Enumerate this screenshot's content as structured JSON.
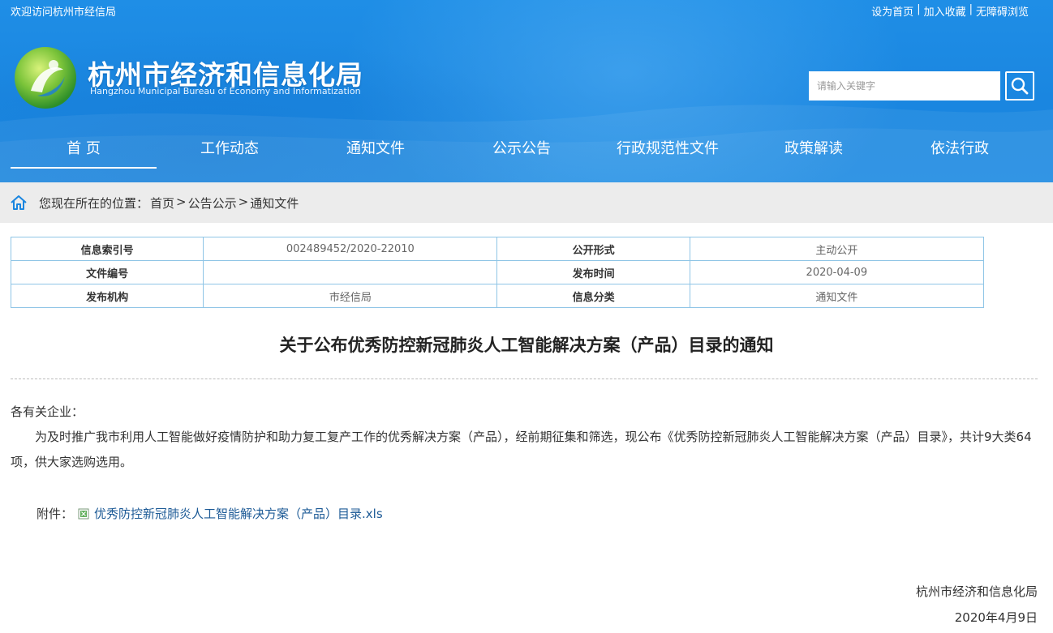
{
  "topbar": {
    "welcome": "欢迎访问杭州市经信局",
    "links": [
      "设为首页",
      "|",
      "加入收藏",
      "|",
      "无障碍浏览"
    ]
  },
  "site": {
    "title": "杭州市经济和信息化局",
    "subtitle": "Hangzhou Municipal Bureau of Economy and Informatization"
  },
  "search": {
    "placeholder": "请输入关键字"
  },
  "nav": {
    "items": [
      {
        "label": "首 页",
        "active": true
      },
      {
        "label": "工作动态"
      },
      {
        "label": "通知文件"
      },
      {
        "label": "公示公告"
      },
      {
        "label": "行政规范性文件"
      },
      {
        "label": "政策解读"
      },
      {
        "label": "依法行政"
      }
    ]
  },
  "breadcrumb": {
    "prefix": "您现在所在的位置：",
    "items": [
      "首页",
      ">",
      "公告公示",
      ">",
      "通知文件"
    ]
  },
  "info": {
    "rows": [
      {
        "k1": "信息索引号",
        "v1": "002489452/2020-22010",
        "k2": "公开形式",
        "v2": "主动公开"
      },
      {
        "k1": "文件编号",
        "v1": "",
        "k2": "发布时间",
        "v2": "2020-04-09"
      },
      {
        "k1": "发布机构",
        "v1": "市经信局",
        "k2": "信息分类",
        "v2": "通知文件"
      }
    ]
  },
  "article": {
    "title": "关于公布优秀防控新冠肺炎人工智能解决方案（产品）目录的通知",
    "greeting": "各有关企业：",
    "paragraph": "为及时推广我市利用人工智能做好疫情防护和助力复工复产工作的优秀解决方案（产品），经前期征集和筛选，现公布《优秀防控新冠肺炎人工智能解决方案（产品）目录》，共计9大类64项，供大家选购选用。",
    "attachment_label": "附件：",
    "attachment_name": "优秀防控新冠肺炎人工智能解决方案（产品）目录.xls",
    "signature_org": "杭州市经济和信息化局",
    "signature_date": "2020年4月9日"
  },
  "colors": {
    "header_blue": "#1a86e0",
    "table_border": "#8fc5e6",
    "link": "#1c5a96",
    "crumb_bg": "#ececec"
  }
}
